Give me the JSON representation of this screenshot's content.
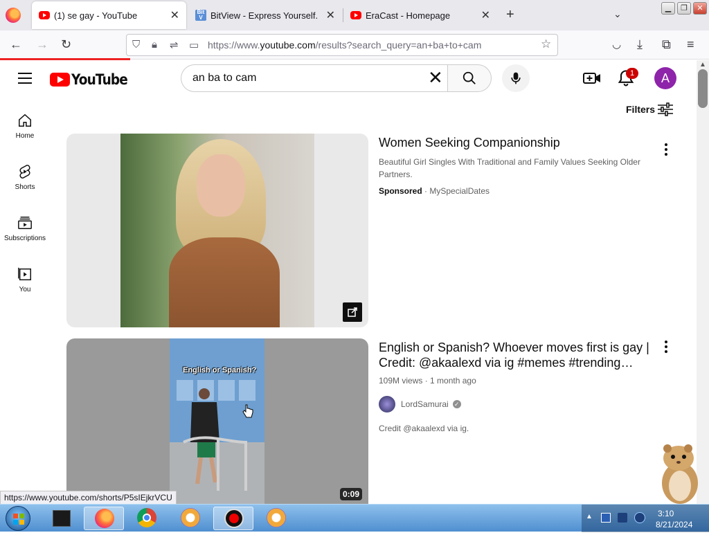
{
  "browser": {
    "tabs": [
      {
        "title": "(1) se gay - YouTube",
        "active": true,
        "favicon": "youtube-icon"
      },
      {
        "title": "BitView - Express Yourself.",
        "active": false,
        "favicon": "bitview-icon"
      },
      {
        "title": "EraCast - Homepage",
        "active": false,
        "favicon": "youtube-icon"
      }
    ],
    "url_prefix": "https://www.",
    "url_domain": "youtube.com",
    "url_suffix": "/results?search_query=an+ba+to+cam",
    "status_url": "https://www.youtube.com/shorts/P5sIEjkrVCU"
  },
  "youtube": {
    "logo_text": "YouTube",
    "search_value": "an ba to cam",
    "notification_count": "1",
    "avatar_letter": "A",
    "filters_label": "Filters",
    "guide": [
      {
        "label": "Home",
        "icon": "home-icon"
      },
      {
        "label": "Shorts",
        "icon": "shorts-icon"
      },
      {
        "label": "Subscriptions",
        "icon": "subscriptions-icon"
      },
      {
        "label": "You",
        "icon": "you-icon"
      }
    ],
    "results": [
      {
        "title": "Women Seeking Companionship",
        "description_line1": "Beautiful Girl Singles With Traditional and Family Values Seeking Older",
        "description_line2": "Partners.",
        "sponsored_label": "Sponsored",
        "advertiser": "MySpecialDates"
      },
      {
        "title_line1": "English or Spanish? Whoever moves first is gay |",
        "title_line2": "Credit: @akaalexd via ig #memes #trending…",
        "views": "109M views",
        "age": "1 month ago",
        "channel": "LordSamurai",
        "description": "Credit @akaalexd via ig.",
        "duration": "0:09",
        "thumb_overlay": "English or Spanish?"
      }
    ]
  },
  "taskbar": {
    "time": "3:10",
    "date": "8/21/2024"
  },
  "colors": {
    "youtube_red": "#ff0000",
    "badge_red": "#cc0000",
    "avatar_purple": "#8e24aa",
    "taskbar_blue": "#4f8fd0"
  }
}
